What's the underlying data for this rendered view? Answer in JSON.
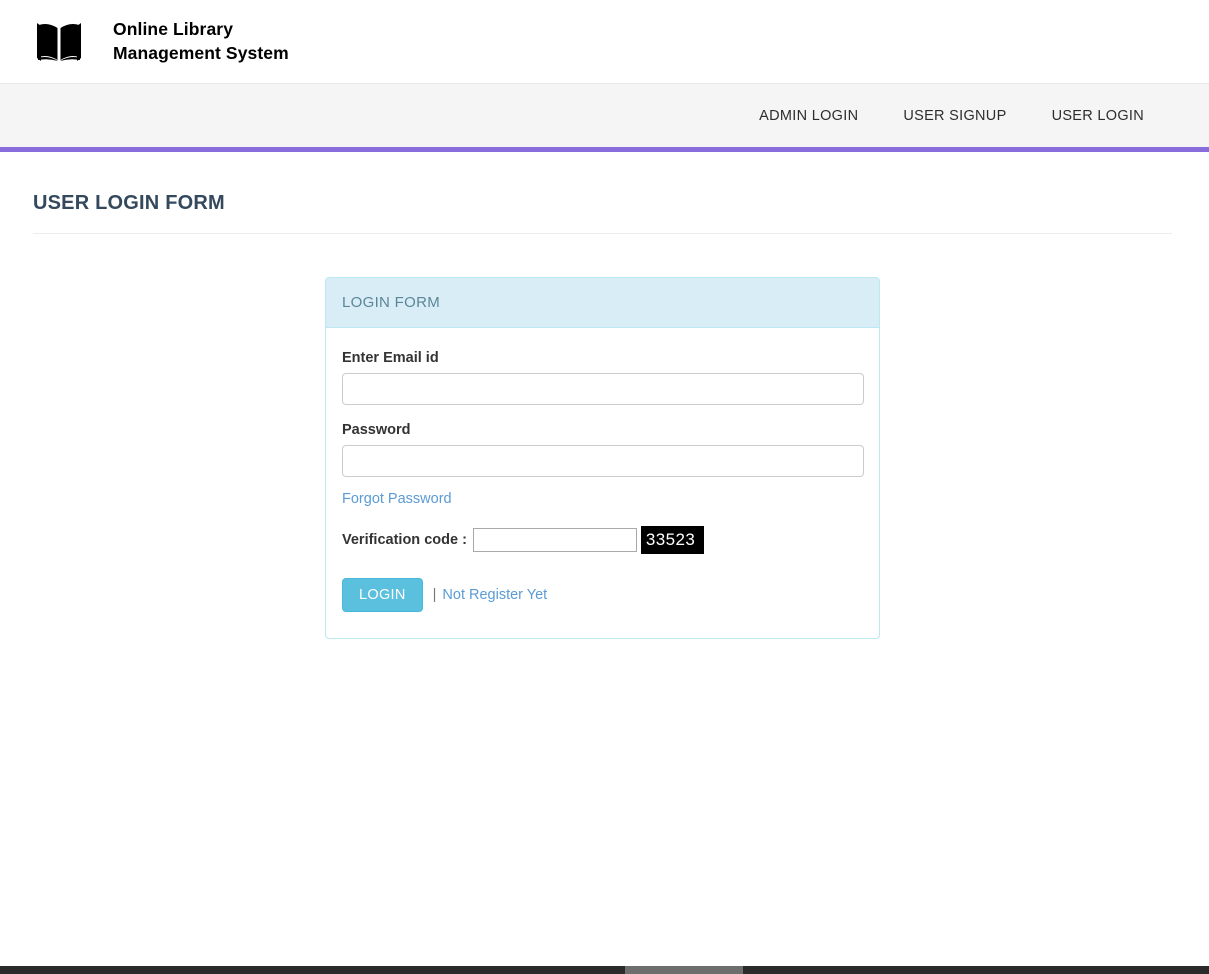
{
  "header": {
    "logo_icon": "open-book-icon",
    "title_line1": "Online Library",
    "title_line2": "Management System"
  },
  "nav": {
    "items": [
      {
        "label": "ADMIN LOGIN"
      },
      {
        "label": "USER SIGNUP"
      },
      {
        "label": "USER LOGIN"
      }
    ],
    "accent_color": "#8a6ddd",
    "background_color": "#f5f5f5"
  },
  "main": {
    "page_title": "USER LOGIN FORM"
  },
  "login_panel": {
    "heading": "LOGIN FORM",
    "heading_bg": "#d9edf7",
    "border_color": "#bce8f1",
    "email": {
      "label": "Enter Email id",
      "value": "",
      "placeholder": ""
    },
    "password": {
      "label": "Password",
      "value": "",
      "placeholder": ""
    },
    "forgot_password_link": "Forgot Password",
    "captcha": {
      "label": "Verification code :",
      "input_value": "",
      "code": "33523",
      "code_bg": "#000000",
      "code_color": "#ffffff"
    },
    "submit_label": "LOGIN",
    "submit_color": "#5bc0de",
    "separator": "|",
    "register_link": "Not Register Yet"
  }
}
